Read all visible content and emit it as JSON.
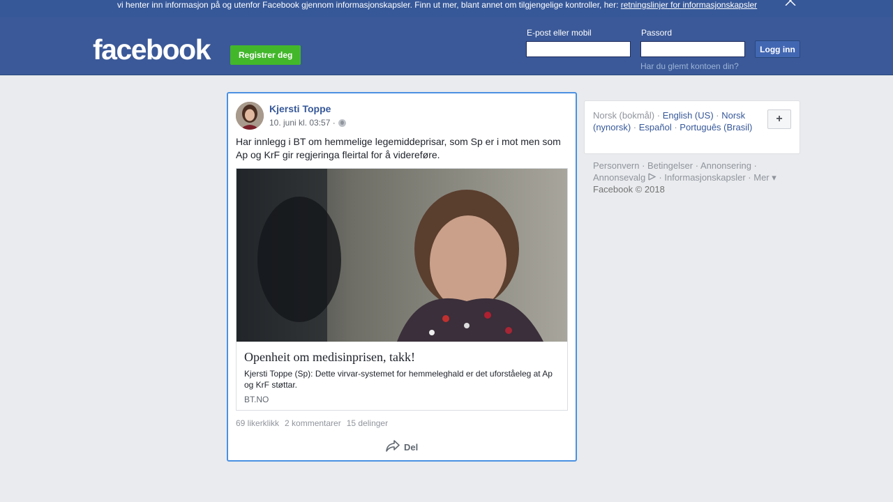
{
  "cookie_banner": {
    "text": "vi henter inn informasjon på og utenfor Facebook gjennom informasjonskapsler. Finn ut mer, blant annet om tilgjengelige kontroller, her: ",
    "link": "retningslinjer for informasjonskapsler",
    "close_icon": "close-icon"
  },
  "header": {
    "logo": "facebook",
    "register_label": "Registrer deg",
    "email_label": "E-post eller mobil",
    "email_value": "",
    "password_label": "Passord",
    "password_value": "",
    "login_label": "Logg inn",
    "forgot_label": "Har du glemt kontoen din?"
  },
  "post": {
    "author": "Kjersti Toppe",
    "timestamp": "10. juni kl. 03:57 ·",
    "privacy_icon": "globe-icon",
    "text": "Har innlegg i BT om hemmelige legemiddeprisar, som Sp er i mot men som Ap og KrF gir regjeringa fleirtal for å videreføre.",
    "link_preview": {
      "title": "Openheit om medisinprisen, takk!",
      "description": "Kjersti Toppe (Sp): Dette virvar-systemet for hemmeleghald er det uforståeleg at Ap og KrF støttar.",
      "source": "BT.NO"
    },
    "likes": "69 likerklikk",
    "comments": "2 kommentarer",
    "shares": "15 delinger",
    "share_label": "Del"
  },
  "languages": {
    "current": "Norsk (bokmål)",
    "items": [
      "English (US)",
      "Norsk (nynorsk)",
      "Español",
      "Português (Brasil)"
    ],
    "add_label": "+"
  },
  "footer": {
    "links": [
      "Personvern",
      "Betingelser",
      "Annonsering",
      "Annonsevalg",
      "Informasjonskapsler",
      "Mer"
    ],
    "copyright": "Facebook © 2018"
  },
  "colors": {
    "brand_blue": "#3b5998",
    "cookie_bar": "#365899",
    "register_green": "#42b72a",
    "focus_border": "#4a90e2",
    "link_blue": "#365899"
  }
}
